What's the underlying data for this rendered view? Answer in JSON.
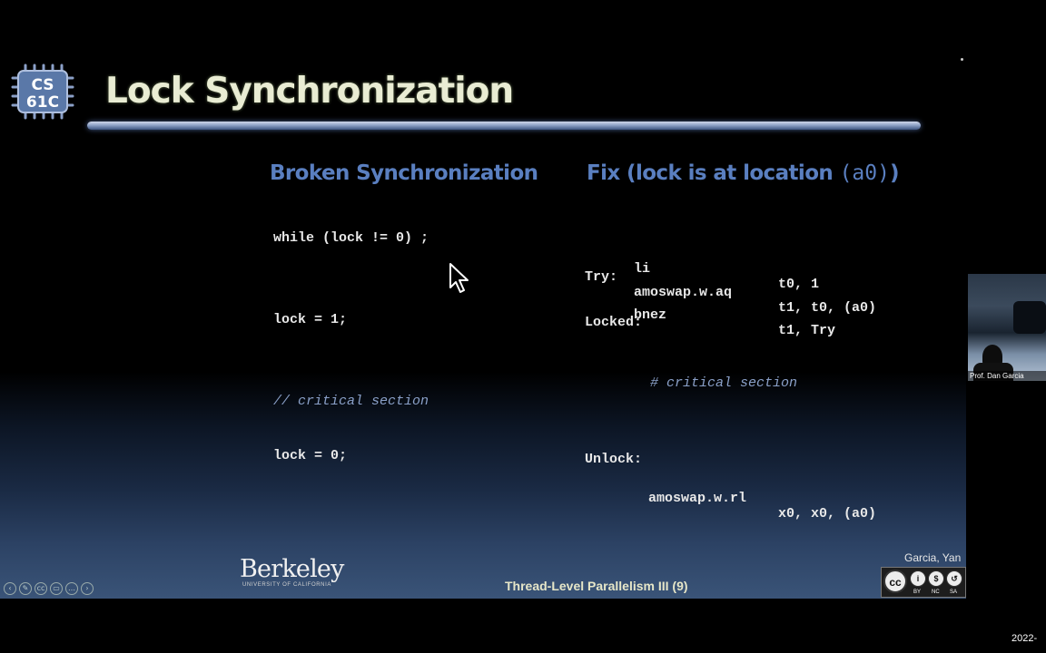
{
  "slide": {
    "logo_text_top": "CS",
    "logo_text_bottom": "61C",
    "title": "Lock Synchronization",
    "left": {
      "heading": "Broken Synchronization",
      "lines": [
        "while (lock != 0) ;",
        "lock = 1;",
        "// critical section",
        "lock = 0;"
      ]
    },
    "right": {
      "heading_text": "Fix (lock is at location ",
      "heading_code": "(a0)",
      "heading_end": ")",
      "rows": [
        {
          "label": "",
          "op": "li",
          "args": "t0, 1"
        },
        {
          "label": "Try:",
          "op": "amoswap.w.aq",
          "args": "t1, t0, (a0)"
        },
        {
          "label": "",
          "op": "bnez",
          "args": "t1, Try"
        },
        {
          "label": "Locked:",
          "op": "",
          "args": ""
        }
      ],
      "comment": "# critical section",
      "unlock_label": "Unlock:",
      "unlock_op": "amoswap.w.rl",
      "unlock_args": "x0, x0, (a0)"
    },
    "footer": {
      "berkeley": "Berkeley",
      "berkeley_sub": "UNIVERSITY OF CALIFORNIA",
      "lecture": "Thread-Level Parallelism III (9)",
      "authors": "Garcia, Yan",
      "license_labels": [
        "BY",
        "NC",
        "SA"
      ]
    }
  },
  "player_controls": [
    {
      "name": "previous-slide",
      "glyph": "‹"
    },
    {
      "name": "pen-tool",
      "glyph": "✎"
    },
    {
      "name": "captions",
      "glyph": "cc"
    },
    {
      "name": "video-toggle",
      "glyph": "▭"
    },
    {
      "name": "more-options",
      "glyph": "…"
    },
    {
      "name": "next-slide",
      "glyph": "›"
    }
  ],
  "video": {
    "speaker_label": "Prof. Dan Garcia"
  },
  "corner_text": "2022-"
}
